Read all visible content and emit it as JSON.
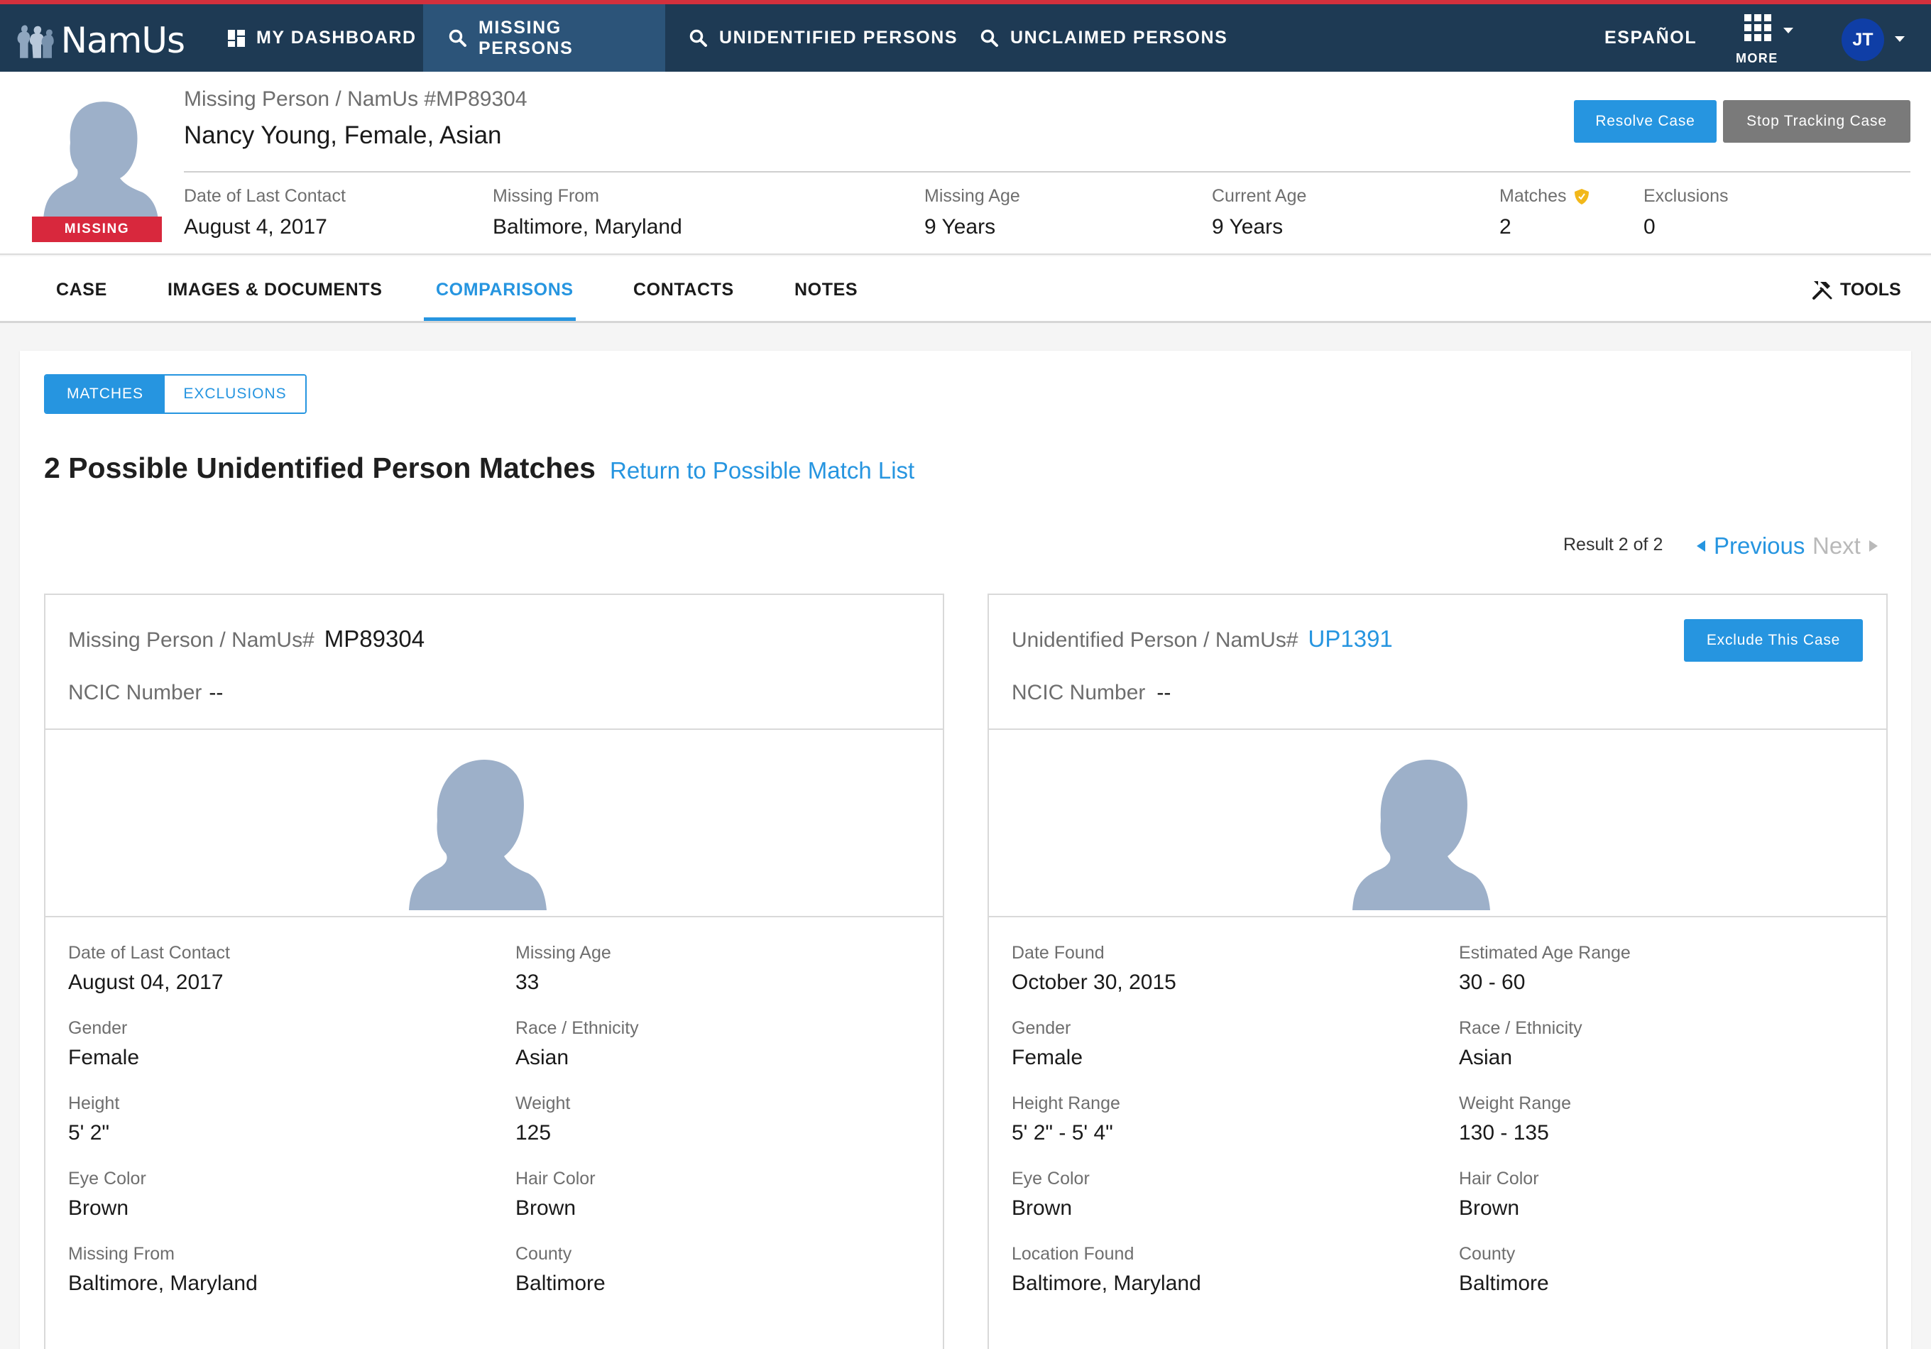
{
  "nav": {
    "logo_text": "NamUs",
    "items": [
      {
        "label": "MY DASHBOARD"
      },
      {
        "label": "MISSING PERSONS"
      },
      {
        "label": "UNIDENTIFIED PERSONS"
      },
      {
        "label": "UNCLAIMED PERSONS"
      }
    ],
    "language": "ESPAÑOL",
    "more_label": "MORE",
    "avatar_initials": "JT"
  },
  "case": {
    "subtitle": "Missing Person / NamUs #MP89304",
    "name": "Nancy Young, Female, Asian",
    "status_badge": "MISSING",
    "resolve_button": "Resolve Case",
    "stop_tracking_button": "Stop Tracking Case",
    "stats": [
      {
        "label": "Date of Last Contact",
        "value": "August 4, 2017"
      },
      {
        "label": "Missing From",
        "value": "Baltimore, Maryland"
      },
      {
        "label": "Missing Age",
        "value": "9 Years"
      },
      {
        "label": "Current Age",
        "value": "9 Years"
      },
      {
        "label": "Matches",
        "value": "2"
      },
      {
        "label": "Exclusions",
        "value": "0"
      }
    ]
  },
  "tabs": [
    {
      "label": "CASE"
    },
    {
      "label": "IMAGES & DOCUMENTS"
    },
    {
      "label": "COMPARISONS"
    },
    {
      "label": "CONTACTS"
    },
    {
      "label": "NOTES"
    }
  ],
  "tools_label": "TOOLS",
  "comparison": {
    "toggle": {
      "matches": "MATCHES",
      "exclusions": "EXCLUSIONS"
    },
    "title": "2 Possible Unidentified Person Matches",
    "return_link": "Return to Possible Match List",
    "result": "Result 2 of 2",
    "previous": "Previous",
    "next": "Next",
    "left": {
      "title_prefix": "Missing Person / NamUs#",
      "id": "MP89304",
      "ncic_label": "NCIC Number",
      "ncic_value": "--",
      "fields": [
        {
          "label": "Date of Last Contact",
          "value": "August 04, 2017"
        },
        {
          "label": "Missing Age",
          "value": "33"
        },
        {
          "label": "Gender",
          "value": "Female"
        },
        {
          "label": "Race / Ethnicity",
          "value": "Asian"
        },
        {
          "label": "Height",
          "value": "5' 2\""
        },
        {
          "label": "Weight",
          "value": "125"
        },
        {
          "label": "Eye Color",
          "value": "Brown"
        },
        {
          "label": "Hair Color",
          "value": "Brown"
        },
        {
          "label": "Missing From",
          "value": "Baltimore, Maryland"
        },
        {
          "label": "County",
          "value": "Baltimore"
        }
      ]
    },
    "right": {
      "title_prefix": "Unidentified Person / NamUs#",
      "id": "UP1391",
      "exclude_button": "Exclude This Case",
      "ncic_label": "NCIC Number",
      "ncic_value": "--",
      "fields": [
        {
          "label": "Date Found",
          "value": "October 30, 2015"
        },
        {
          "label": "Estimated Age Range",
          "value": "30 - 60"
        },
        {
          "label": "Gender",
          "value": "Female"
        },
        {
          "label": "Race / Ethnicity",
          "value": "Asian"
        },
        {
          "label": "Height Range",
          "value": "5' 2\" - 5' 4\""
        },
        {
          "label": "Weight Range",
          "value": "130 - 135"
        },
        {
          "label": "Eye Color",
          "value": "Brown"
        },
        {
          "label": "Hair Color",
          "value": "Brown"
        },
        {
          "label": "Location Found",
          "value": "Baltimore, Maryland"
        },
        {
          "label": "County",
          "value": "Baltimore"
        }
      ]
    }
  },
  "colors": {
    "nav_bg": "#1e3a54",
    "nav_active": "#2c5479",
    "accent_red": "#d3303d",
    "link_blue": "#2695e0",
    "avatar_blue": "#0f3ea6",
    "silhouette": "#9db0c9",
    "matches_shield": "#f2b81a"
  }
}
